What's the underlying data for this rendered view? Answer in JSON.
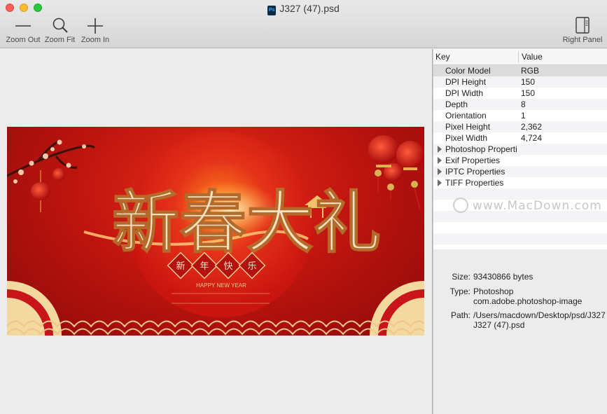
{
  "window": {
    "title": "J327 (47).psd",
    "file_badge": "Ps"
  },
  "toolbar": {
    "zoom_out": "Zoom Out",
    "zoom_fit": "Zoom Fit",
    "zoom_in": "Zoom In",
    "right_panel": "Right Panel"
  },
  "image": {
    "calligraphy": "新春大礼",
    "seals": [
      "新",
      "年",
      "快",
      "乐"
    ],
    "english": "HAPPY NEW YEAR",
    "colors": {
      "bg": "#c1150f",
      "gold": "#f2c58a"
    }
  },
  "table": {
    "headers": {
      "key": "Key",
      "value": "Value"
    },
    "rows": [
      {
        "key": "Color Model",
        "value": "RGB",
        "expandable": false
      },
      {
        "key": "DPI Height",
        "value": "150",
        "expandable": false
      },
      {
        "key": "DPI Width",
        "value": "150",
        "expandable": false
      },
      {
        "key": "Depth",
        "value": "8",
        "expandable": false
      },
      {
        "key": "Orientation",
        "value": "1",
        "expandable": false
      },
      {
        "key": "Pixel Height",
        "value": "2,362",
        "expandable": false
      },
      {
        "key": "Pixel Width",
        "value": "4,724",
        "expandable": false
      },
      {
        "key": "Photoshop Properti",
        "value": "",
        "expandable": true
      },
      {
        "key": "Exif Properties",
        "value": "",
        "expandable": true
      },
      {
        "key": "IPTC Properties",
        "value": "",
        "expandable": true
      },
      {
        "key": "TIFF Properties",
        "value": "",
        "expandable": true
      }
    ]
  },
  "watermark": "www.MacDown.com",
  "info": {
    "size_label": "Size:",
    "size_value": "93430866 bytes",
    "type_label": "Type:",
    "type_value_1": "Photoshop",
    "type_value_2": "com.adobe.photoshop-image",
    "path_label": "Path:",
    "path_value_1": "/Users/macdown/Desktop/psd/J327 (47).psd",
    "path_value_2": "J327 (47).psd"
  }
}
